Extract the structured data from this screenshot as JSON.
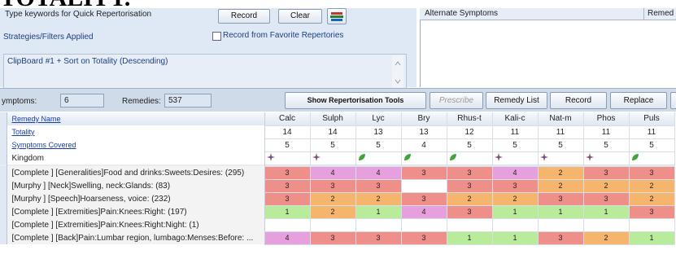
{
  "banner": {
    "text": "TOTALITY."
  },
  "search": {
    "label": "Type keywords for Quick Repertorisation"
  },
  "toolbar": {
    "record_label": "Record",
    "clear_label": "Clear",
    "book_icon": "book-stack-icon"
  },
  "filters": {
    "label": "Strategies/Filters Applied",
    "favorite_label": "Record from Favorite Repertories",
    "favorite_checked": false
  },
  "clipboard": {
    "text": "ClipBoard #1 + Sort on Totality (Descending)"
  },
  "alternate": {
    "header": "Alternate Symptoms",
    "header2": "Remed"
  },
  "counts": {
    "symptoms_label": "ymptoms:",
    "symptoms_value": "6",
    "remedies_label": "Remedies:",
    "remedies_value": "537"
  },
  "actions": {
    "show_tools": "Show Repertorisation Tools",
    "prescribe": "Prescribe",
    "remedy_list": "Remedy List",
    "record": "Record",
    "replace": "Replace"
  },
  "grid": {
    "header_name": "Remedy Name",
    "remedies": [
      "Calc",
      "Sulph",
      "Lyc",
      "Bry",
      "Rhus-t",
      "Kali-c",
      "Nat-m",
      "Phos",
      "Puls"
    ],
    "totality_label": "Totality",
    "totality": [
      "14",
      "14",
      "13",
      "13",
      "12",
      "11",
      "11",
      "11",
      "11"
    ],
    "covered_label": "Symptoms Covered",
    "covered": [
      "5",
      "5",
      "5",
      "4",
      "5",
      "5",
      "5",
      "5",
      "5"
    ],
    "kingdom_label": "Kingdom",
    "kingdom": [
      "mineral",
      "mineral",
      "plant",
      "plant",
      "plant",
      "mineral",
      "mineral",
      "mineral",
      "plant"
    ],
    "colors": {
      "red": "#ef8f8a",
      "pink": "#e7a0de",
      "green": "#b8eb9a",
      "orange": "#f6b56c"
    },
    "rubrics": [
      {
        "name": "[Complete ] [Generalities]Food and drinks:Sweets:Desires: (295)",
        "grades": [
          "3",
          "4",
          "4",
          "3",
          "3",
          "4",
          "2",
          "3",
          "3"
        ],
        "colors": [
          "red",
          "pink",
          "pink",
          "red",
          "red",
          "pink",
          "orange",
          "red",
          "red"
        ]
      },
      {
        "name": "[Murphy ] [Neck]Swelling, neck:Glands: (83)",
        "grades": [
          "3",
          "3",
          "3",
          "",
          "3",
          "3",
          "2",
          "2",
          "2"
        ],
        "colors": [
          "red",
          "red",
          "red",
          "white",
          "red",
          "red",
          "orange",
          "orange",
          "orange"
        ]
      },
      {
        "name": "[Murphy ] [Speech]Hoarseness, voice: (232)",
        "grades": [
          "3",
          "2",
          "2",
          "3",
          "2",
          "2",
          "3",
          "3",
          "2"
        ],
        "colors": [
          "red",
          "orange",
          "orange",
          "red",
          "orange",
          "orange",
          "red",
          "red",
          "orange"
        ]
      },
      {
        "name": "[Complete ] [Extremities]Pain:Knees:Right: (197)",
        "grades": [
          "1",
          "2",
          "1",
          "4",
          "3",
          "1",
          "1",
          "1",
          "3"
        ],
        "colors": [
          "green",
          "orange",
          "green",
          "pink",
          "red",
          "green",
          "green",
          "green",
          "red"
        ]
      },
      {
        "name": "[Complete ] [Extremities]Pain:Knees:Right:Night: (1)",
        "grades": [
          "",
          "",
          "",
          "",
          "",
          "",
          "",
          "",
          ""
        ],
        "colors": [
          "white",
          "white",
          "white",
          "white",
          "white",
          "white",
          "white",
          "white",
          "white"
        ]
      },
      {
        "name": "[Complete ] [Back]Pain:Lumbar region, lumbago:Menses:Before: ...",
        "grades": [
          "4",
          "3",
          "3",
          "3",
          "1",
          "1",
          "3",
          "2",
          "1"
        ],
        "colors": [
          "pink",
          "red",
          "red",
          "red",
          "green",
          "green",
          "red",
          "orange",
          "green"
        ]
      }
    ]
  }
}
